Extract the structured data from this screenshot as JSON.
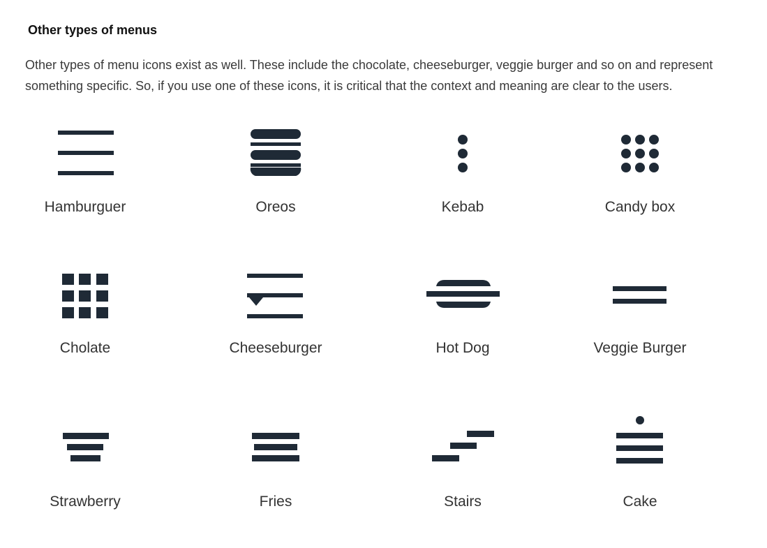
{
  "article": {
    "heading": "Other types of menus",
    "intro": "Other types of menu icons exist as well. These include the chocolate, cheeseburger, veggie burger and so on and represent something specific. So, if you use one of these icons, it is critical that the context and meaning are clear to the users."
  },
  "icon_color": "#1f2a36",
  "menus": [
    {
      "label": "Hamburguer",
      "icon": "hamburger-icon"
    },
    {
      "label": "Oreos",
      "icon": "oreos-icon"
    },
    {
      "label": "Kebab",
      "icon": "kebab-icon"
    },
    {
      "label": "Candy box",
      "icon": "candy-box-icon"
    },
    {
      "label": "Cholate",
      "icon": "chocolate-icon"
    },
    {
      "label": "Cheeseburger",
      "icon": "cheeseburger-icon"
    },
    {
      "label": "Hot Dog",
      "icon": "hot-dog-icon"
    },
    {
      "label": "Veggie Burger",
      "icon": "veggie-burger-icon"
    },
    {
      "label": "Strawberry",
      "icon": "strawberry-icon"
    },
    {
      "label": "Fries",
      "icon": "fries-icon"
    },
    {
      "label": "Stairs",
      "icon": "stairs-icon"
    },
    {
      "label": "Cake",
      "icon": "cake-icon"
    }
  ]
}
